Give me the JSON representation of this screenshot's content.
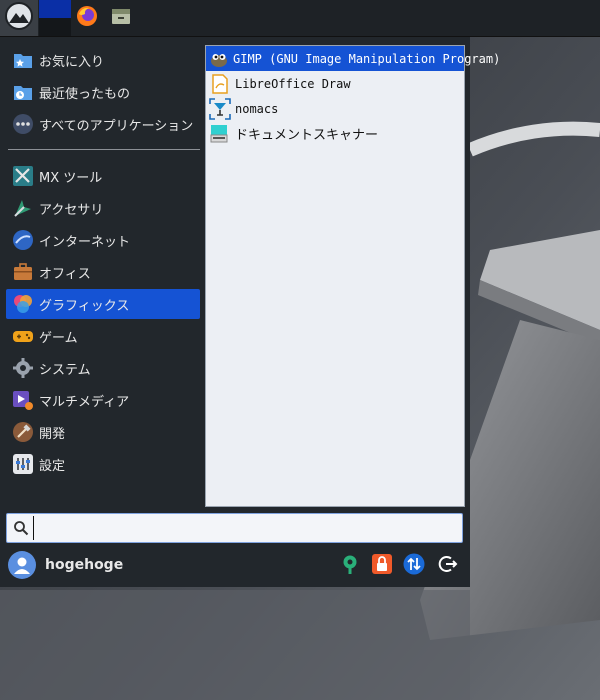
{
  "panel": {
    "start_icon": "mx-logo-icon",
    "firefox_icon": "firefox-icon",
    "files_icon": "file-manager-icon"
  },
  "menu": {
    "categories": [
      {
        "label": "お気に入り",
        "icon": "favorites-folder-icon"
      },
      {
        "label": "最近使ったもの",
        "icon": "recent-folder-icon"
      },
      {
        "label": "すべてのアプリケーション",
        "icon": "all-apps-icon"
      },
      {
        "label": "MX ツール",
        "icon": "mx-tools-icon"
      },
      {
        "label": "アクセサリ",
        "icon": "accessories-icon"
      },
      {
        "label": "インターネット",
        "icon": "internet-icon"
      },
      {
        "label": "オフィス",
        "icon": "office-icon"
      },
      {
        "label": "グラフィックス",
        "icon": "graphics-icon",
        "selected": true
      },
      {
        "label": "ゲーム",
        "icon": "games-icon"
      },
      {
        "label": "システム",
        "icon": "system-icon"
      },
      {
        "label": "マルチメディア",
        "icon": "multimedia-icon"
      },
      {
        "label": "開発",
        "icon": "development-icon"
      },
      {
        "label": "設定",
        "icon": "settings-icon"
      }
    ],
    "apps": [
      {
        "label": "GIMP (GNU Image Manipulation Program)",
        "icon": "gimp-icon",
        "selected": true
      },
      {
        "label": "LibreOffice Draw",
        "icon": "libreoffice-draw-icon"
      },
      {
        "label": "nomacs",
        "icon": "nomacs-icon"
      },
      {
        "label": "ドキュメントスキャナー",
        "icon": "document-scanner-icon"
      }
    ],
    "search": {
      "value": "",
      "placeholder": ""
    },
    "user": {
      "name": "hogehoge"
    },
    "actions": [
      "settings-manager-icon",
      "lock-icon",
      "switch-user-icon",
      "logout-icon"
    ]
  },
  "colors": {
    "accent": "#1553d4",
    "menu_bg": "#22272c",
    "panel_bg": "#1e2226",
    "list_bg": "#eceff4"
  }
}
